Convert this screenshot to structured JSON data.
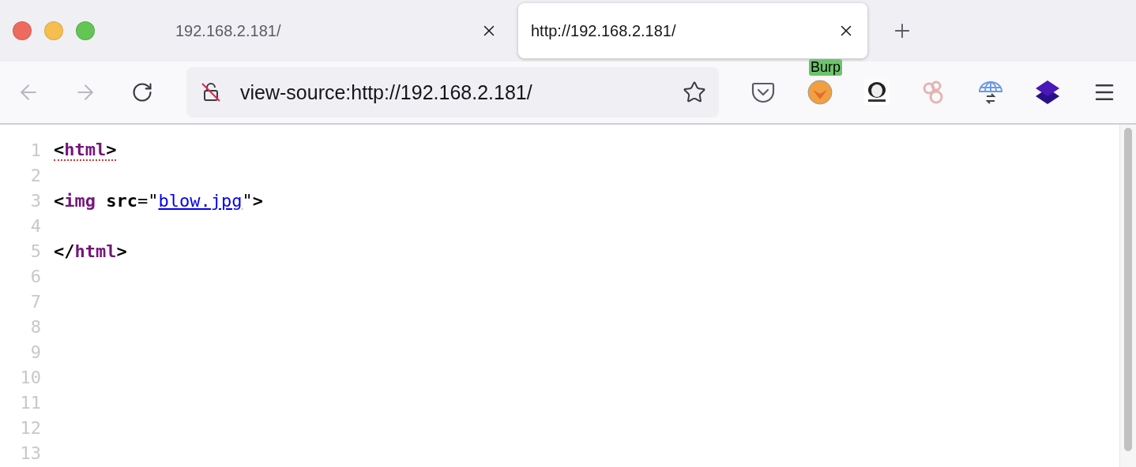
{
  "tabs": [
    {
      "title": "192.168.2.181/",
      "selected": false
    },
    {
      "title": "http://192.168.2.181/",
      "selected": true
    }
  ],
  "toolbar": {
    "address": "view-source:http://192.168.2.181/",
    "extension_badge": "Burp"
  },
  "source": {
    "lines": [
      {
        "number": "1",
        "error": true,
        "tokens": [
          {
            "kind": "punct",
            "text": "<"
          },
          {
            "kind": "tag",
            "text": "html"
          },
          {
            "kind": "punct",
            "text": ">"
          }
        ]
      },
      {
        "number": "2"
      },
      {
        "number": "3",
        "error": false,
        "tokens": [
          {
            "kind": "punct",
            "text": "<"
          },
          {
            "kind": "tag",
            "text": "img"
          },
          {
            "kind": "attr",
            "text": " src"
          },
          {
            "kind": "plain",
            "text": "=\""
          },
          {
            "kind": "link",
            "text": "blow.jpg"
          },
          {
            "kind": "plain",
            "text": "\""
          },
          {
            "kind": "punct",
            "text": ">"
          }
        ]
      },
      {
        "number": "4"
      },
      {
        "number": "5",
        "error": false,
        "tokens": [
          {
            "kind": "punct",
            "text": "</"
          },
          {
            "kind": "tag",
            "text": "html"
          },
          {
            "kind": "punct",
            "text": ">"
          }
        ]
      },
      {
        "number": "6"
      },
      {
        "number": "7"
      },
      {
        "number": "8"
      },
      {
        "number": "9"
      },
      {
        "number": "10"
      },
      {
        "number": "11"
      },
      {
        "number": "12"
      },
      {
        "number": "13"
      }
    ]
  }
}
